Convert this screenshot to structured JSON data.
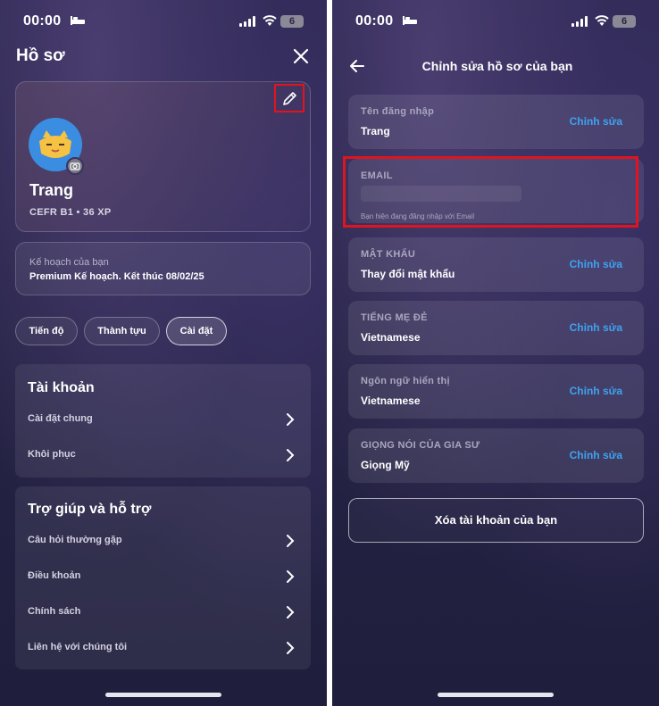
{
  "status": {
    "time": "00:00",
    "battery": "6"
  },
  "left": {
    "title": "Hồ sơ",
    "profile": {
      "name": "Trang",
      "subtitle": "CEFR B1 • 36 XP"
    },
    "plan": {
      "label": "Kế hoạch của bạn",
      "text": "Premium Kế hoạch. Kết thúc 08/02/25"
    },
    "tabs": [
      {
        "label": "Tiến độ"
      },
      {
        "label": "Thành tựu"
      },
      {
        "label": "Cài đặt"
      }
    ],
    "account": {
      "title": "Tài khoản",
      "items": [
        {
          "label": "Cài đặt chung"
        },
        {
          "label": "Khôi phục"
        }
      ]
    },
    "help": {
      "title": "Trợ giúp và hỗ trợ",
      "items": [
        {
          "label": "Câu hỏi thường gặp"
        },
        {
          "label": "Điều khoản"
        },
        {
          "label": "Chính sách"
        },
        {
          "label": "Liên hệ với chúng tôi"
        }
      ]
    }
  },
  "right": {
    "title": "Chỉnh sửa hồ sơ của bạn",
    "fields": [
      {
        "label": "Tên đăng nhập",
        "value": "Trang",
        "action": "Chỉnh sửa"
      },
      {
        "label": "EMAIL",
        "value": "",
        "note": "Bạn hiện đang đăng nhập với Email"
      },
      {
        "label": "MẬT KHẨU",
        "value": "Thay đổi mật khẩu",
        "action": "Chỉnh sửa"
      },
      {
        "label": "TIẾNG MẸ ĐẺ",
        "value": "Vietnamese",
        "action": "Chỉnh sửa"
      },
      {
        "label": "Ngôn ngữ hiển thị",
        "value": "Vietnamese",
        "action": "Chỉnh sửa"
      },
      {
        "label": "GIỌNG NÓI CỦA GIA SƯ",
        "value": "Giọng Mỹ",
        "action": "Chỉnh sửa"
      }
    ],
    "delete_label": "Xóa tài khoản của bạn"
  },
  "colors": {
    "accent_link": "#3fa2f0",
    "highlight": "#e0141e"
  }
}
